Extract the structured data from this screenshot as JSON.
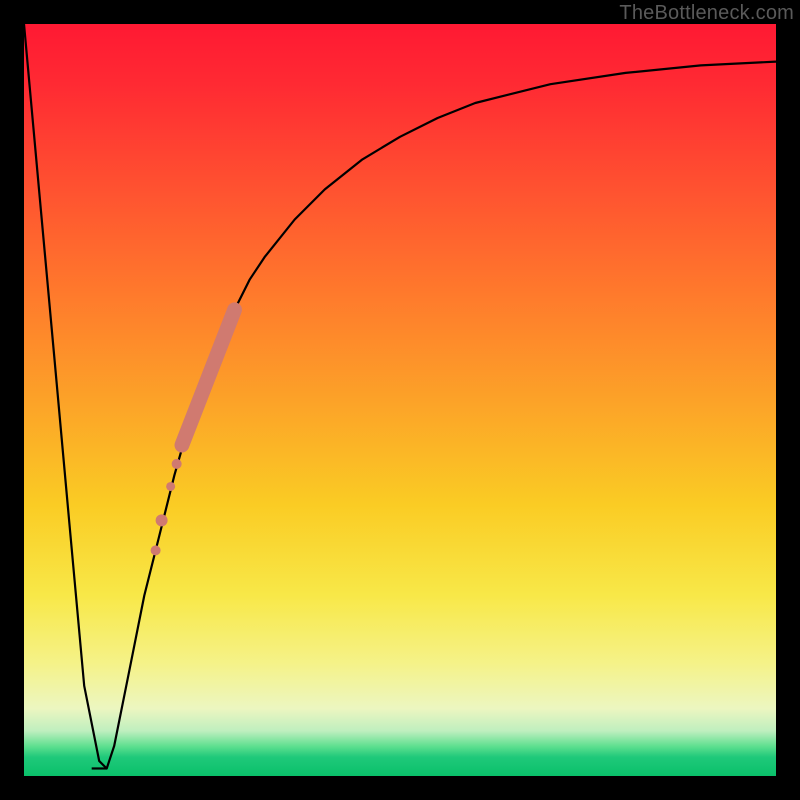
{
  "watermark": "TheBottleneck.com",
  "colors": {
    "curve_stroke": "#000000",
    "highlight_fill": "#d07a70",
    "dot_fill": "#d07a70"
  },
  "chart_data": {
    "type": "line",
    "title": "",
    "xlabel": "",
    "ylabel": "",
    "xlim": [
      0,
      100
    ],
    "ylim": [
      0,
      100
    ],
    "x": [
      0,
      2,
      4,
      6,
      8,
      10,
      11,
      12,
      14,
      16,
      18,
      20,
      22,
      24,
      26,
      28,
      30,
      32,
      36,
      40,
      45,
      50,
      55,
      60,
      70,
      80,
      90,
      100
    ],
    "values": [
      100,
      78,
      56,
      34,
      12,
      2,
      1,
      4,
      14,
      24,
      32,
      40,
      47,
      53,
      58,
      62,
      66,
      69,
      74,
      78,
      82,
      85,
      87.5,
      89.5,
      92,
      93.5,
      94.5,
      95
    ],
    "notch": {
      "x_start": 9,
      "x_end": 11,
      "y": 1
    },
    "highlight_segment": {
      "x_start": 21,
      "x_end": 28,
      "y_start": 44,
      "y_end": 62,
      "thickness": 7
    },
    "dots": [
      {
        "x": 20.3,
        "y": 41.5,
        "r": 5
      },
      {
        "x": 19.5,
        "y": 38.5,
        "r": 4.5
      },
      {
        "x": 18.3,
        "y": 34.0,
        "r": 6
      },
      {
        "x": 17.5,
        "y": 30.0,
        "r": 5
      }
    ]
  }
}
